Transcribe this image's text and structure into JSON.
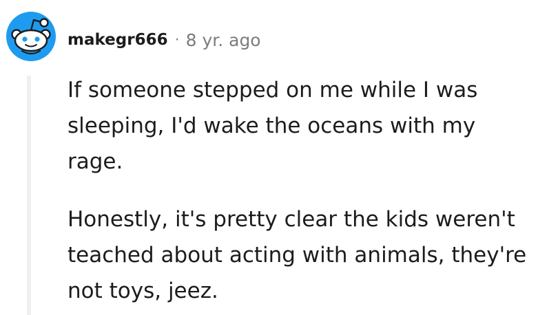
{
  "comment": {
    "avatar_icon": "reddit-snoo-avatar-icon",
    "username": "makegr666",
    "separator": "·",
    "timestamp": "8 yr. ago",
    "paragraphs": [
      "If someone stepped on me while I was sleeping, I'd wake the oceans with my rage.",
      "Honestly, it's pretty clear the kids weren't teached about acting with animals, they're not toys, jeez."
    ]
  },
  "colors": {
    "avatar_blue": "#1e9bf0",
    "text": "#1c1c1c",
    "meta": "#7c7c7c",
    "thread_line": "#edeff1"
  }
}
